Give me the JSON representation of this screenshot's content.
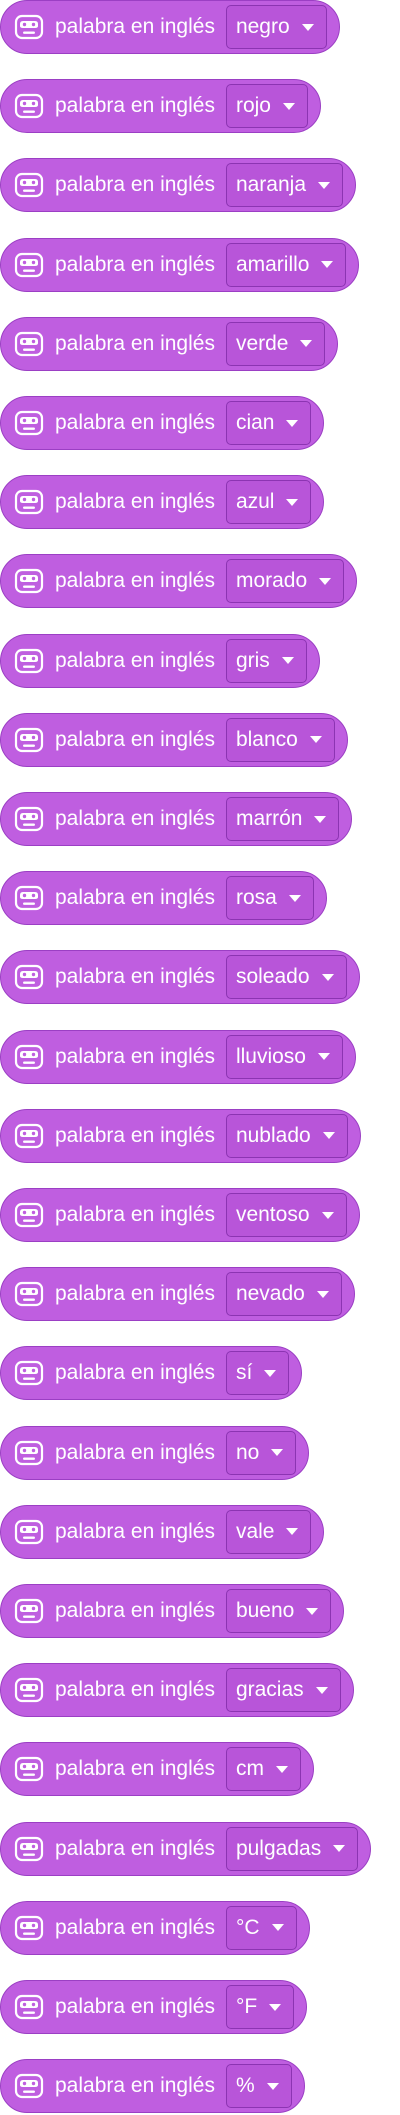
{
  "colors": {
    "block_fill": "#bf5ee0",
    "block_border": "#9b3fc4",
    "dropdown_fill": "#b855d9",
    "dropdown_border": "#8c34b2",
    "text": "#ffffff"
  },
  "block_label": "palabra en inglés",
  "block_icon": "translate-robot-icon",
  "blocks": [
    {
      "label": "palabra en inglés",
      "value": "negro"
    },
    {
      "label": "palabra en inglés",
      "value": "rojo"
    },
    {
      "label": "palabra en inglés",
      "value": "naranja"
    },
    {
      "label": "palabra en inglés",
      "value": "amarillo"
    },
    {
      "label": "palabra en inglés",
      "value": "verde"
    },
    {
      "label": "palabra en inglés",
      "value": "cian"
    },
    {
      "label": "palabra en inglés",
      "value": "azul"
    },
    {
      "label": "palabra en inglés",
      "value": "morado"
    },
    {
      "label": "palabra en inglés",
      "value": "gris"
    },
    {
      "label": "palabra en inglés",
      "value": "blanco"
    },
    {
      "label": "palabra en inglés",
      "value": "marrón"
    },
    {
      "label": "palabra en inglés",
      "value": "rosa"
    },
    {
      "label": "palabra en inglés",
      "value": "soleado"
    },
    {
      "label": "palabra en inglés",
      "value": "lluvioso"
    },
    {
      "label": "palabra en inglés",
      "value": "nublado"
    },
    {
      "label": "palabra en inglés",
      "value": "ventoso"
    },
    {
      "label": "palabra en inglés",
      "value": "nevado"
    },
    {
      "label": "palabra en inglés",
      "value": "sí"
    },
    {
      "label": "palabra en inglés",
      "value": "no"
    },
    {
      "label": "palabra en inglés",
      "value": "vale"
    },
    {
      "label": "palabra en inglés",
      "value": "bueno"
    },
    {
      "label": "palabra en inglés",
      "value": "gracias"
    },
    {
      "label": "palabra en inglés",
      "value": "cm"
    },
    {
      "label": "palabra en inglés",
      "value": "pulgadas"
    },
    {
      "label": "palabra en inglés",
      "value": "°C"
    },
    {
      "label": "palabra en inglés",
      "value": "°F"
    },
    {
      "label": "palabra en inglés",
      "value": "%"
    }
  ]
}
